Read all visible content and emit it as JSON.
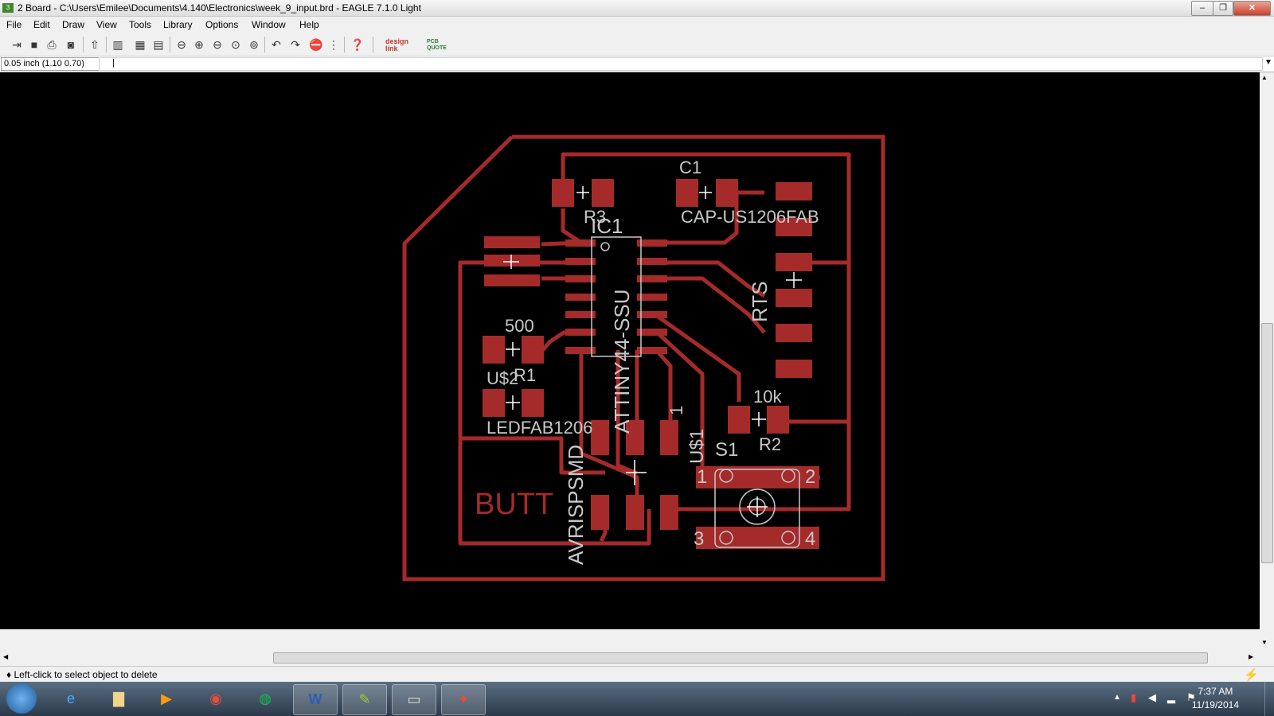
{
  "window": {
    "title": "2 Board - C:\\Users\\Emilee\\Documents\\4.140\\Electronics\\week_9_input.brd - EAGLE 7.1.0 Light",
    "app_icon_text": "3"
  },
  "menu": {
    "items": [
      "File",
      "Edit",
      "Draw",
      "View",
      "Tools",
      "Library",
      "Options",
      "Window",
      "Help"
    ]
  },
  "toolbar": {
    "designlink_label": "design link",
    "pcbquote_label": "PCB QUOTE"
  },
  "command": {
    "coord": "0.05 inch (1.10 0.70)",
    "value": "|"
  },
  "board": {
    "labels": {
      "c1": "C1",
      "cap": "CAP-US1206FAB",
      "r3": "R3",
      "ic1": "IC1",
      "attiny": "ATTINY44-SSU",
      "rts": "RTS",
      "r500": "500",
      "r1": "R1",
      "us2": "U$2",
      "ledfab": "LEDFAB1206",
      "one": "1",
      "us1": "U$1",
      "r10k": "10k",
      "s1": "S1",
      "r2": "R2",
      "avrisp": "AVRISPSMD",
      "butt": "BUTT",
      "pin1": "1",
      "pin2": "2",
      "pin3": "3",
      "pin4": "4"
    },
    "colors": {
      "copper": "#a52a2a",
      "silk": "#c8c8c8",
      "background": "#000000"
    }
  },
  "status": {
    "message": "♦ Left-click to select object to delete"
  },
  "taskbar": {
    "time": "7:37 AM",
    "date": "11/19/2014"
  }
}
